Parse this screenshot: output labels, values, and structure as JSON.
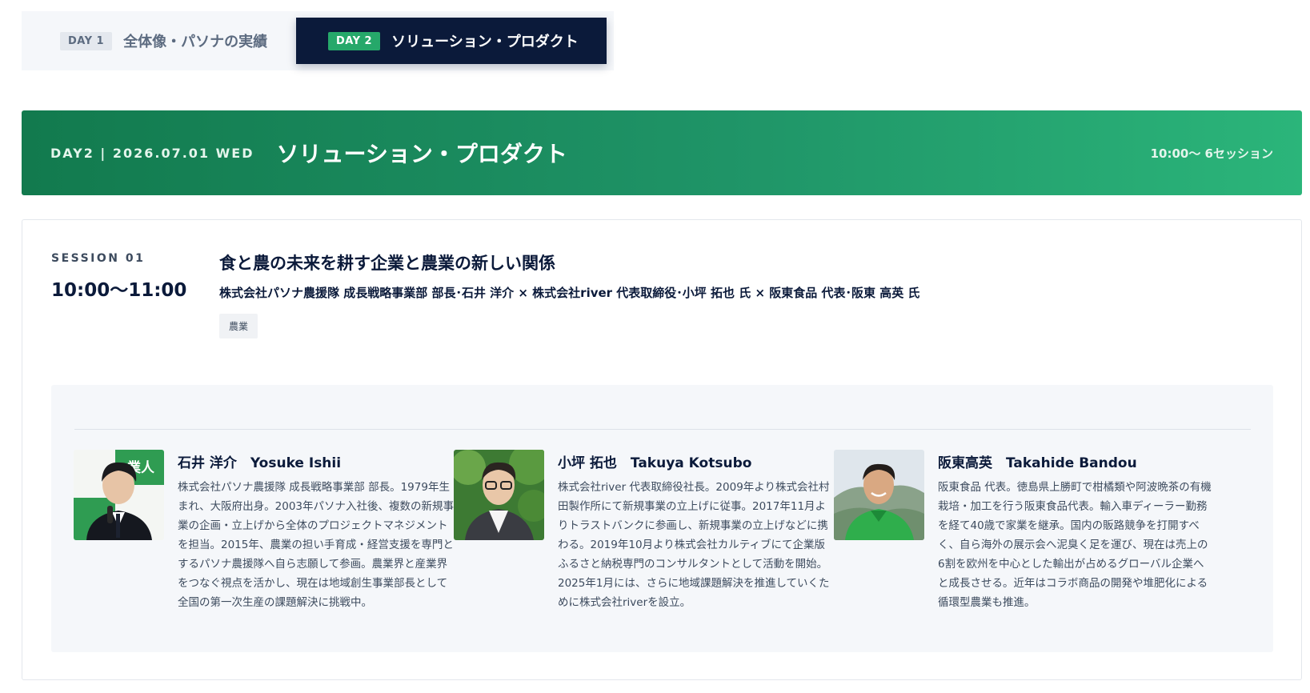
{
  "tabs": [
    {
      "badge": "DAY 1",
      "label": "全体像・パソナの実績"
    },
    {
      "badge": "DAY 2",
      "label": "ソリューション・プロダクト"
    }
  ],
  "banner": {
    "date": "DAY2 | 2026.07.01 WED",
    "title": "ソリューション・プロダクト",
    "meta": "10:00〜 6セッション"
  },
  "session": {
    "label": "SESSION 01",
    "time": "10:00〜11:00",
    "title": "食と農の未来を耕す企業と農業の新しい関係",
    "speakers": "株式会社パソナ農援隊 成長戦略事業部 部長･石井 洋介 × 株式会社river 代表取締役･小坪 拓也 氏 × 阪東食品 代表･阪東 高英 氏",
    "tag": "農業"
  },
  "profiles": [
    {
      "name": "石井 洋介　Yosuke Ishii",
      "bio": "株式会社パソナ農援隊 成長戦略事業部 部長。1979年生まれ、大阪府出身。2003年パソナ入社後、複数の新規事業の企画・立上げから全体のプロジェクトマネジメントを担当。2015年、農業の担い手育成・経営支援を専門とするパソナ農援隊へ自ら志願して参画。農業界と産業界をつなぐ視点を活かし、現在は地域創生事業部長として全国の第一次生産の課題解決に挑戦中。",
      "avatar_banner_text": "業人"
    },
    {
      "name": "小坪 拓也　Takuya Kotsubo",
      "bio": "株式会社river 代表取締役社長。2009年より株式会社村田製作所にて新規事業の立上げに従事。2017年11月よりトラストバンクに参画し、新規事業の立上げなどに携わる。2019年10月より株式会社カルティブにて企業版ふるさと納税専門のコンサルタントとして活動を開始。2025年1月には、さらに地域課題解決を推進していくために株式会社riverを設立。"
    },
    {
      "name": "阪東高英　Takahide Bandou",
      "bio": "阪東食品 代表。徳島県上勝町で柑橘類や阿波晩茶の有機栽培・加工を行う阪東食品代表。輸入車ディーラー勤務を経て40歳で家業を継承。国内の販路競争を打開すべく、自ら海外の展示会へ泥臭く足を運び、現在は売上の6割を欧州を中心とした輸出が占めるグローバル企業へと成長させる。近年はコラボ商品の開発や堆肥化による循環型農業も推進。"
    }
  ],
  "colors": {
    "navy": "#0b1a3a",
    "green": "#26a86a",
    "banner_start": "#127a4e",
    "banner_end": "#2bb57a"
  }
}
